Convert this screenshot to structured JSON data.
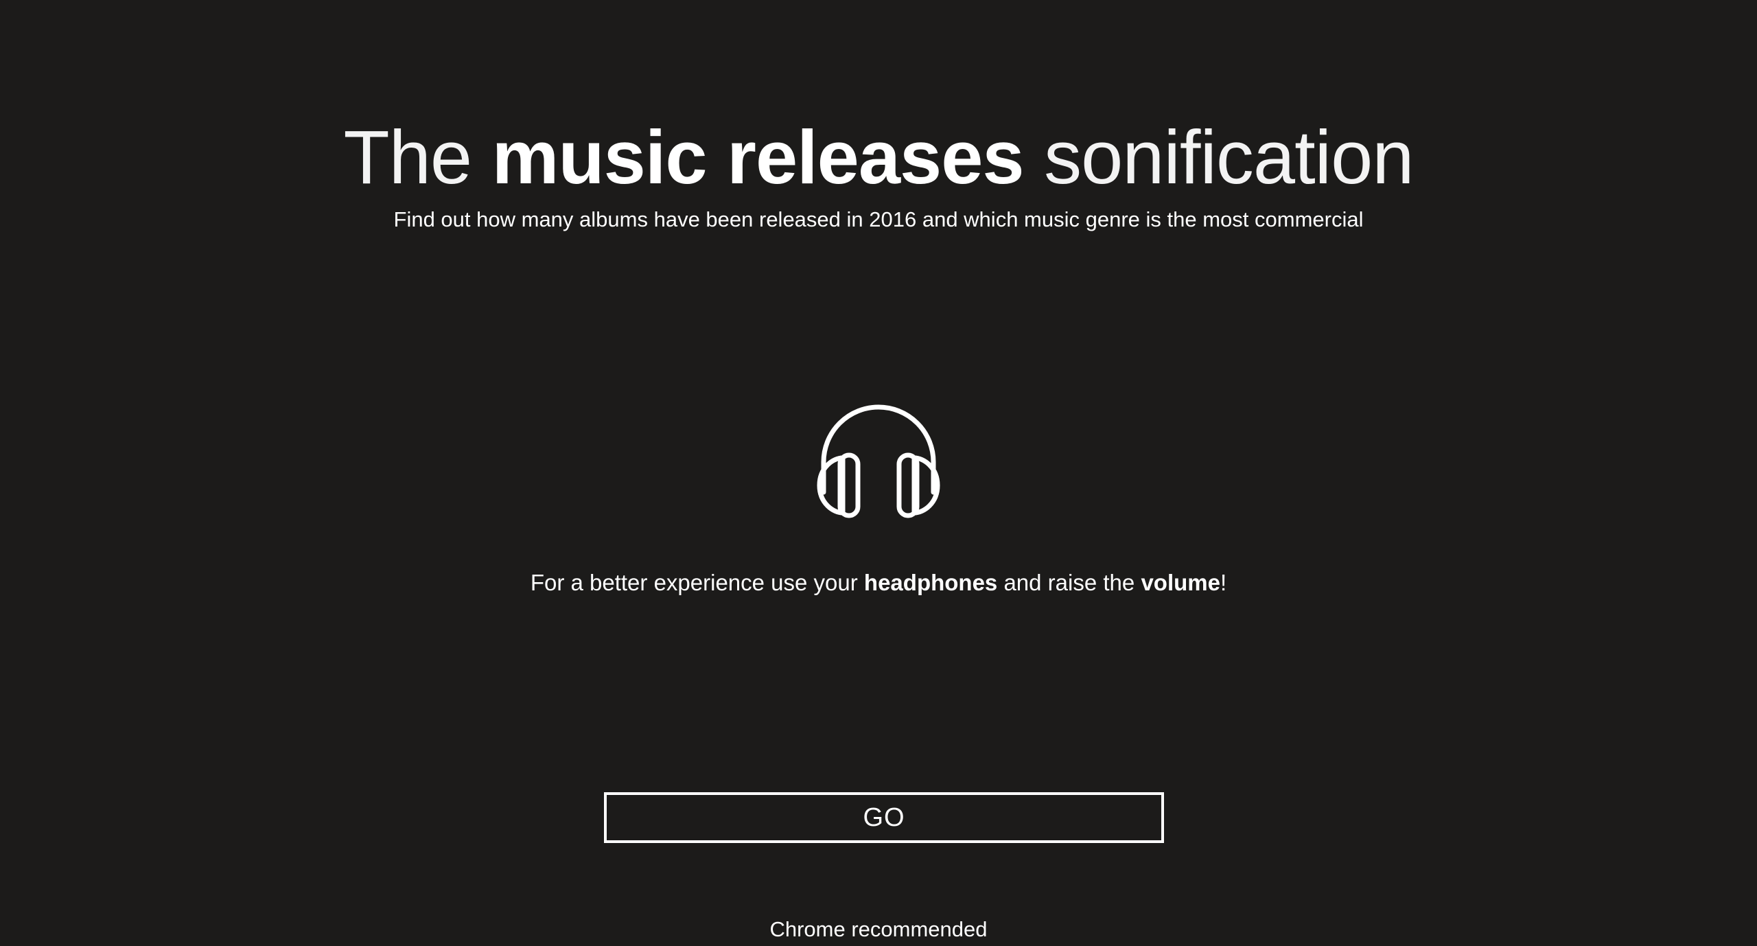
{
  "header": {
    "title_prefix": "The",
    "title_bold": "music releases",
    "title_suffix": "sonification",
    "subtitle": "Find out how many albums have been released in 2016 and which music genre is the most commercial"
  },
  "main": {
    "icon": "headphones-icon",
    "hint_part1": "For a better experience use your",
    "hint_bold1": "headphones",
    "hint_part2": "and raise the",
    "hint_bold2": "volume",
    "hint_end": "!"
  },
  "actions": {
    "go_label": "GO"
  },
  "footer": {
    "note": "Chrome recommended"
  },
  "colors": {
    "background": "#1c1b1a",
    "foreground": "#ffffff"
  }
}
